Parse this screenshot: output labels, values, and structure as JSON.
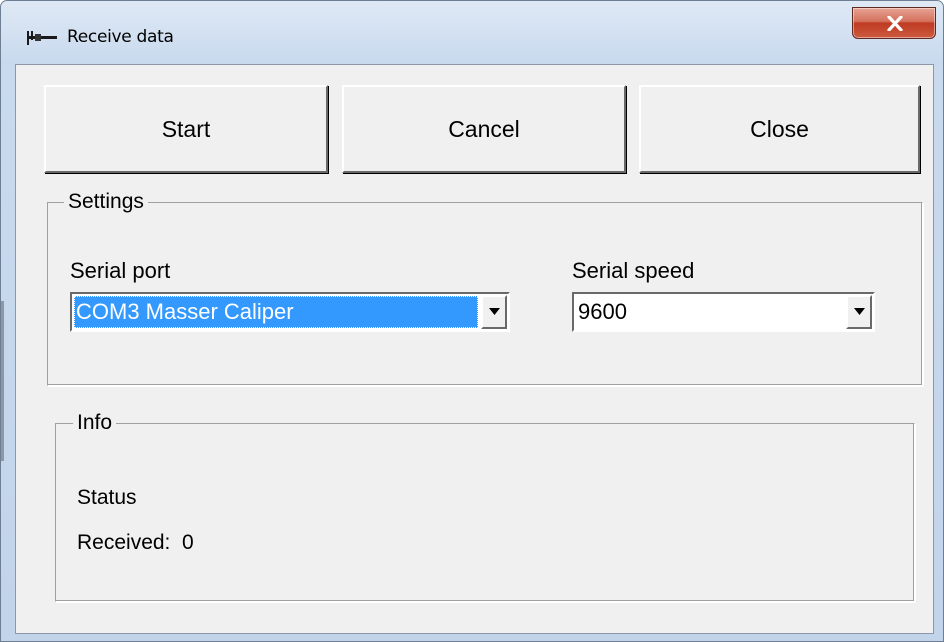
{
  "window": {
    "title": "Receive data",
    "app_icon": "caliper-icon",
    "close_icon": "close-icon"
  },
  "toolbar": {
    "start_label": "Start",
    "cancel_label": "Cancel",
    "close_label": "Close"
  },
  "settings": {
    "legend": "Settings",
    "serial_port_label": "Serial port",
    "serial_port_value": "COM3 Masser Caliper",
    "serial_speed_label": "Serial speed",
    "serial_speed_value": "9600"
  },
  "info": {
    "legend": "Info",
    "status_text": "Status",
    "received_text": "Received:  0"
  },
  "colors": {
    "selection": "#3399ff",
    "close_button": "#c75a42",
    "dialog_face": "#f0f0f0"
  }
}
